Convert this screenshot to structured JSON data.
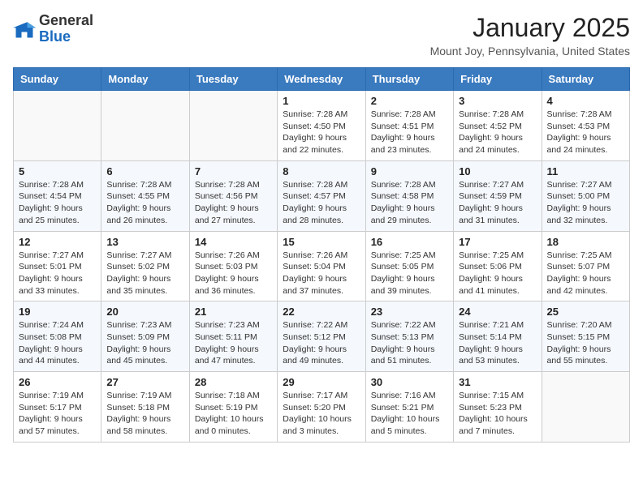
{
  "logo": {
    "general": "General",
    "blue": "Blue"
  },
  "header": {
    "month": "January 2025",
    "location": "Mount Joy, Pennsylvania, United States"
  },
  "days_of_week": [
    "Sunday",
    "Monday",
    "Tuesday",
    "Wednesday",
    "Thursday",
    "Friday",
    "Saturday"
  ],
  "weeks": [
    [
      {
        "day": "",
        "info": ""
      },
      {
        "day": "",
        "info": ""
      },
      {
        "day": "",
        "info": ""
      },
      {
        "day": "1",
        "info": "Sunrise: 7:28 AM\nSunset: 4:50 PM\nDaylight: 9 hours\nand 22 minutes."
      },
      {
        "day": "2",
        "info": "Sunrise: 7:28 AM\nSunset: 4:51 PM\nDaylight: 9 hours\nand 23 minutes."
      },
      {
        "day": "3",
        "info": "Sunrise: 7:28 AM\nSunset: 4:52 PM\nDaylight: 9 hours\nand 24 minutes."
      },
      {
        "day": "4",
        "info": "Sunrise: 7:28 AM\nSunset: 4:53 PM\nDaylight: 9 hours\nand 24 minutes."
      }
    ],
    [
      {
        "day": "5",
        "info": "Sunrise: 7:28 AM\nSunset: 4:54 PM\nDaylight: 9 hours\nand 25 minutes."
      },
      {
        "day": "6",
        "info": "Sunrise: 7:28 AM\nSunset: 4:55 PM\nDaylight: 9 hours\nand 26 minutes."
      },
      {
        "day": "7",
        "info": "Sunrise: 7:28 AM\nSunset: 4:56 PM\nDaylight: 9 hours\nand 27 minutes."
      },
      {
        "day": "8",
        "info": "Sunrise: 7:28 AM\nSunset: 4:57 PM\nDaylight: 9 hours\nand 28 minutes."
      },
      {
        "day": "9",
        "info": "Sunrise: 7:28 AM\nSunset: 4:58 PM\nDaylight: 9 hours\nand 29 minutes."
      },
      {
        "day": "10",
        "info": "Sunrise: 7:27 AM\nSunset: 4:59 PM\nDaylight: 9 hours\nand 31 minutes."
      },
      {
        "day": "11",
        "info": "Sunrise: 7:27 AM\nSunset: 5:00 PM\nDaylight: 9 hours\nand 32 minutes."
      }
    ],
    [
      {
        "day": "12",
        "info": "Sunrise: 7:27 AM\nSunset: 5:01 PM\nDaylight: 9 hours\nand 33 minutes."
      },
      {
        "day": "13",
        "info": "Sunrise: 7:27 AM\nSunset: 5:02 PM\nDaylight: 9 hours\nand 35 minutes."
      },
      {
        "day": "14",
        "info": "Sunrise: 7:26 AM\nSunset: 5:03 PM\nDaylight: 9 hours\nand 36 minutes."
      },
      {
        "day": "15",
        "info": "Sunrise: 7:26 AM\nSunset: 5:04 PM\nDaylight: 9 hours\nand 37 minutes."
      },
      {
        "day": "16",
        "info": "Sunrise: 7:25 AM\nSunset: 5:05 PM\nDaylight: 9 hours\nand 39 minutes."
      },
      {
        "day": "17",
        "info": "Sunrise: 7:25 AM\nSunset: 5:06 PM\nDaylight: 9 hours\nand 41 minutes."
      },
      {
        "day": "18",
        "info": "Sunrise: 7:25 AM\nSunset: 5:07 PM\nDaylight: 9 hours\nand 42 minutes."
      }
    ],
    [
      {
        "day": "19",
        "info": "Sunrise: 7:24 AM\nSunset: 5:08 PM\nDaylight: 9 hours\nand 44 minutes."
      },
      {
        "day": "20",
        "info": "Sunrise: 7:23 AM\nSunset: 5:09 PM\nDaylight: 9 hours\nand 45 minutes."
      },
      {
        "day": "21",
        "info": "Sunrise: 7:23 AM\nSunset: 5:11 PM\nDaylight: 9 hours\nand 47 minutes."
      },
      {
        "day": "22",
        "info": "Sunrise: 7:22 AM\nSunset: 5:12 PM\nDaylight: 9 hours\nand 49 minutes."
      },
      {
        "day": "23",
        "info": "Sunrise: 7:22 AM\nSunset: 5:13 PM\nDaylight: 9 hours\nand 51 minutes."
      },
      {
        "day": "24",
        "info": "Sunrise: 7:21 AM\nSunset: 5:14 PM\nDaylight: 9 hours\nand 53 minutes."
      },
      {
        "day": "25",
        "info": "Sunrise: 7:20 AM\nSunset: 5:15 PM\nDaylight: 9 hours\nand 55 minutes."
      }
    ],
    [
      {
        "day": "26",
        "info": "Sunrise: 7:19 AM\nSunset: 5:17 PM\nDaylight: 9 hours\nand 57 minutes."
      },
      {
        "day": "27",
        "info": "Sunrise: 7:19 AM\nSunset: 5:18 PM\nDaylight: 9 hours\nand 58 minutes."
      },
      {
        "day": "28",
        "info": "Sunrise: 7:18 AM\nSunset: 5:19 PM\nDaylight: 10 hours\nand 0 minutes."
      },
      {
        "day": "29",
        "info": "Sunrise: 7:17 AM\nSunset: 5:20 PM\nDaylight: 10 hours\nand 3 minutes."
      },
      {
        "day": "30",
        "info": "Sunrise: 7:16 AM\nSunset: 5:21 PM\nDaylight: 10 hours\nand 5 minutes."
      },
      {
        "day": "31",
        "info": "Sunrise: 7:15 AM\nSunset: 5:23 PM\nDaylight: 10 hours\nand 7 minutes."
      },
      {
        "day": "",
        "info": ""
      }
    ]
  ]
}
